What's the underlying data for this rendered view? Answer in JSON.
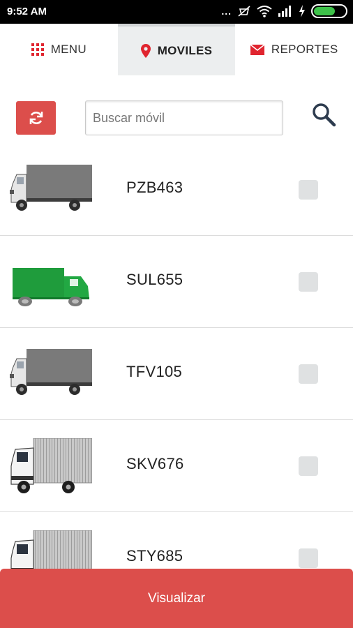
{
  "status_bar": {
    "time": "9:52 AM",
    "dots": "...",
    "battery_color": "#3ec24a"
  },
  "tabs": [
    {
      "label": "MENU",
      "icon": "grid-icon",
      "active": false
    },
    {
      "label": "MOVILES",
      "icon": "map-pin-icon",
      "active": true
    },
    {
      "label": "REPORTES",
      "icon": "envelope-icon",
      "active": false
    }
  ],
  "search": {
    "placeholder": "Buscar móvil",
    "value": ""
  },
  "vehicles": [
    {
      "plate": "PZB463",
      "image": "gray-box-truck",
      "checked": false
    },
    {
      "plate": "SUL655",
      "image": "green-box-truck",
      "checked": false
    },
    {
      "plate": "TFV105",
      "image": "gray-box-truck",
      "checked": false
    },
    {
      "plate": "SKV676",
      "image": "silver-box-truck",
      "checked": false
    },
    {
      "plate": "STY685",
      "image": "silver-box-truck",
      "checked": false
    }
  ],
  "actions": {
    "visualizar_label": "Visualizar"
  },
  "colors": {
    "accent": "#dc4e4b",
    "tab_icon": "#e0252f",
    "active_tab_bg": "#eceeef"
  }
}
